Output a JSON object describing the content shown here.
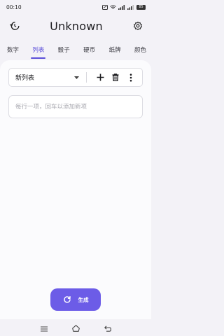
{
  "status_bar": {
    "time": "00:10",
    "battery": "85"
  },
  "app_bar": {
    "title": "Unknown",
    "history_icon": "history-icon",
    "settings_icon": "gear-icon"
  },
  "tabs": [
    {
      "label": "数字",
      "active": false
    },
    {
      "label": "列表",
      "active": true
    },
    {
      "label": "骰子",
      "active": false
    },
    {
      "label": "硬币",
      "active": false
    },
    {
      "label": "纸牌",
      "active": false
    },
    {
      "label": "颜色",
      "active": false
    }
  ],
  "list_toolbar": {
    "selected_list": "新列表",
    "add_icon": "plus-icon",
    "delete_icon": "trash-icon",
    "more_icon": "more-vertical-icon"
  },
  "item_input": {
    "value": "",
    "placeholder": "每行一项，回车以添加新项"
  },
  "generate_button": {
    "label": "生成",
    "icon": "refresh-icon"
  },
  "nav": {
    "menu_icon": "menu-icon",
    "home_icon": "home-icon",
    "back_icon": "back-icon"
  },
  "colors": {
    "accent": "#6c5ce7",
    "tab_active": "#5b4fd9",
    "tab_pill": "#e2e0f6"
  }
}
